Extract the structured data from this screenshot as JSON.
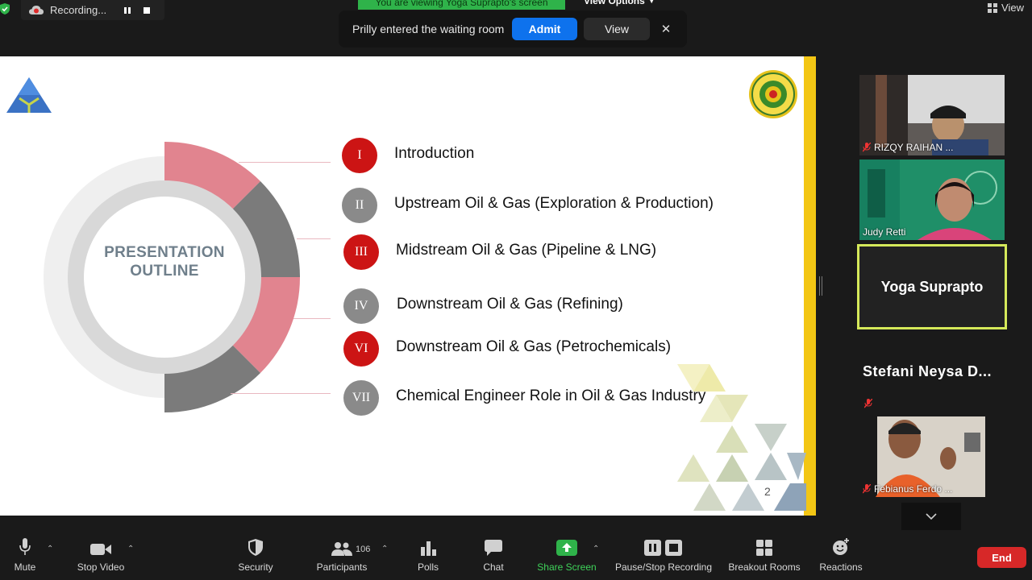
{
  "top_bar": {
    "recording_label": "Recording...",
    "viewing_banner": "You are viewing Yoga Suprapto's screen",
    "view_options_label": "View Options",
    "view_label": "View"
  },
  "notification": {
    "message": "Prilly entered the waiting room",
    "admit_label": "Admit",
    "view_label": "View"
  },
  "slide": {
    "outline_title_line1": "PRESENTATION",
    "outline_title_line2": "OUTLINE",
    "items": [
      {
        "numeral": "I",
        "label": "Introduction",
        "color": "red"
      },
      {
        "numeral": "II",
        "label": "Upstream Oil & Gas (Exploration & Production)",
        "color": "grey"
      },
      {
        "numeral": "III",
        "label": "Midstream Oil & Gas (Pipeline & LNG)",
        "color": "red"
      },
      {
        "numeral": "IV",
        "label": "Downstream Oil & Gas (Refining)",
        "color": "grey"
      },
      {
        "numeral": "VI",
        "label": "Downstream Oil & Gas (Petrochemicals)",
        "color": "red"
      },
      {
        "numeral": "VII",
        "label": "Chemical Engineer Role in Oil & Gas Industry",
        "color": "grey"
      }
    ],
    "page_number": "2",
    "colors": {
      "accent_red": "#cc1414",
      "pink": "#e1848f",
      "grey": "#8a8a8a",
      "yellow": "#f3c614"
    }
  },
  "participants": [
    {
      "name": "RIZQY RAIHAN ...",
      "muted": true,
      "video": true
    },
    {
      "name": "Judy Retti",
      "muted": false,
      "video": true
    },
    {
      "name": "Yoga Suprapto",
      "muted": false,
      "video": false,
      "active_speaker": true
    },
    {
      "name": "Stefani  Neysa  D...",
      "muted": true,
      "video": false
    },
    {
      "name": "Febianus Ferdo ...",
      "muted": true,
      "video": true
    }
  ],
  "toolbar": {
    "mute_label": "Mute",
    "stop_video_label": "Stop Video",
    "security_label": "Security",
    "participants_label": "Participants",
    "participants_count": "106",
    "polls_label": "Polls",
    "chat_label": "Chat",
    "share_screen_label": "Share Screen",
    "recording_label": "Pause/Stop Recording",
    "breakout_label": "Breakout Rooms",
    "reactions_label": "Reactions",
    "end_label": "End",
    "share_color": "#2fb34a",
    "end_color": "#d72828"
  }
}
